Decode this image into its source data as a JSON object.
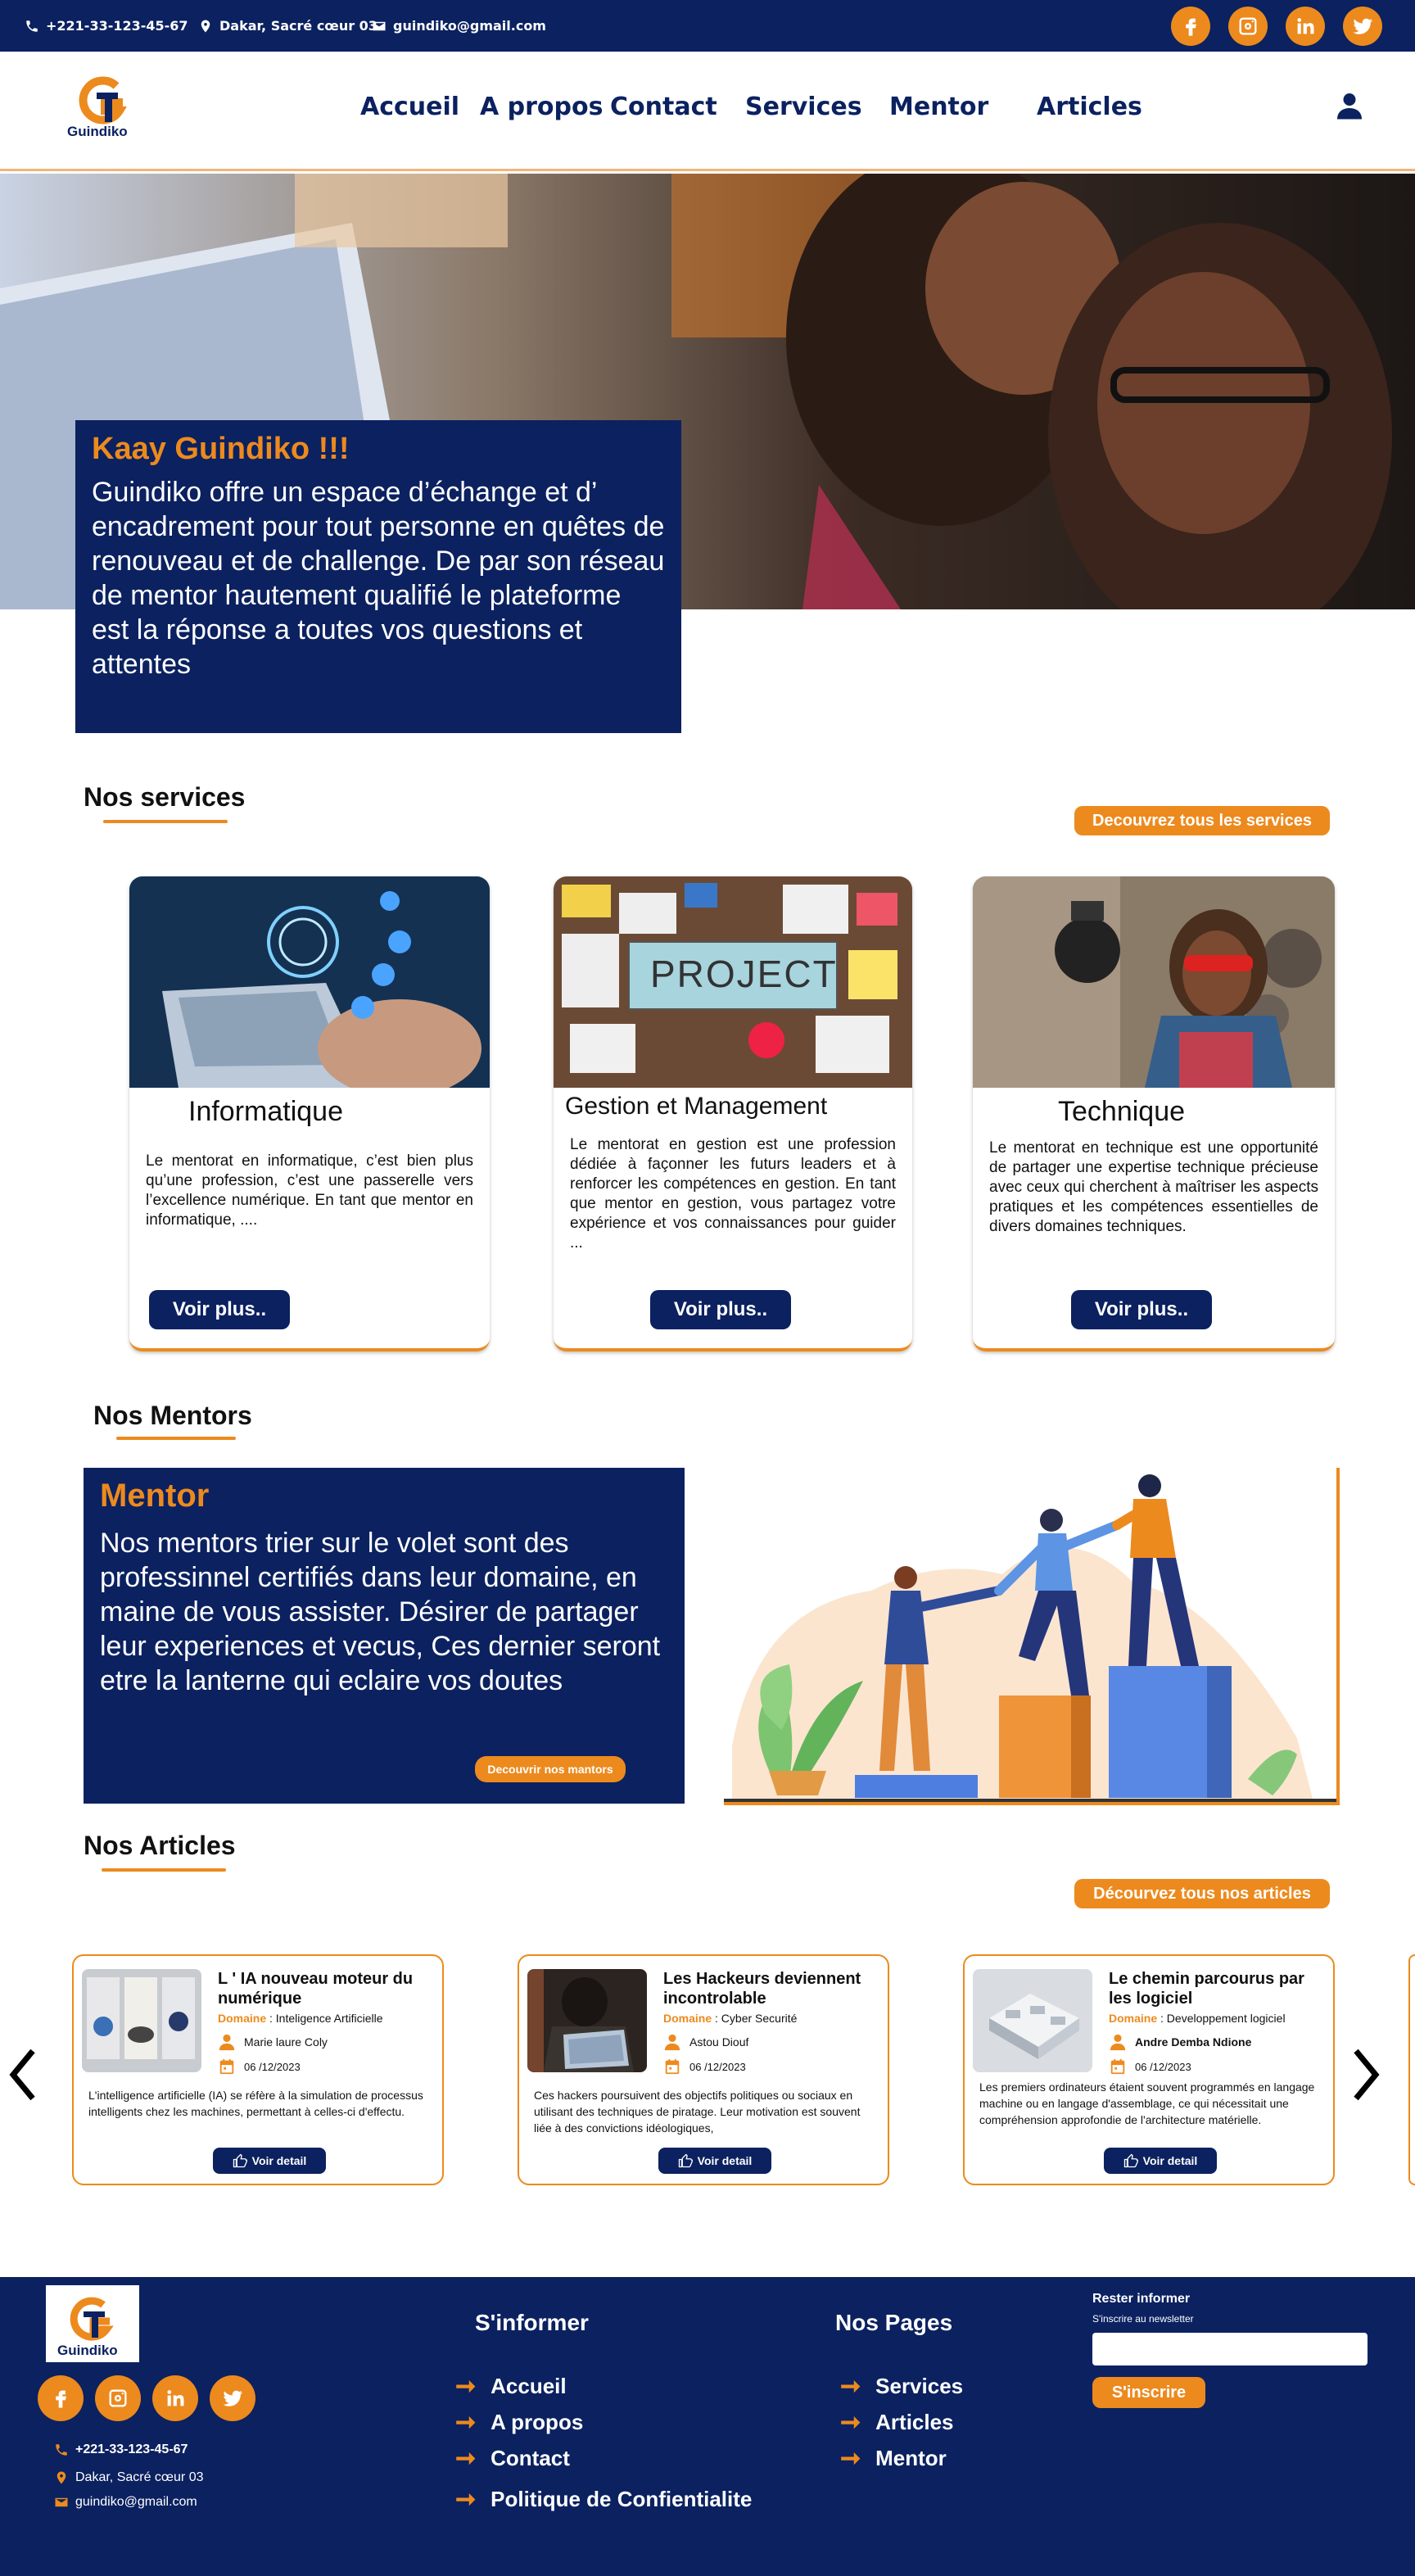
{
  "topbar": {
    "phone": "+221-33-123-45-67",
    "address": "Dakar, Sacré cœur 03",
    "email": "guindiko@gmail.com"
  },
  "brand": {
    "logo_text": "Guindiko",
    "logo_letter": "G"
  },
  "nav": {
    "items": [
      {
        "label": "Accueil"
      },
      {
        "label": "A propos"
      },
      {
        "label": "Contact"
      },
      {
        "label": "Services"
      },
      {
        "label": "Mentor"
      },
      {
        "label": "Articles"
      }
    ]
  },
  "hero": {
    "title": "Kaay Guindiko !!!",
    "text": "Guindiko offre un espace d’échange et d’ encadrement pour tout personne en quêtes de renouveau et de challenge. De par son réseau de mentor hautement qualifié le plateforme est la réponse a toutes vos questions et attentes"
  },
  "services": {
    "title": "Nos services",
    "all_button": "Decouvrez tous les services",
    "cards": [
      {
        "title": "Informatique",
        "text": "Le mentorat en informatique, c’est bien plus qu’une profession, c’est une passerelle vers l’excellence numérique. En tant que mentor en informatique, ....",
        "button": "Voir plus.."
      },
      {
        "title": "Gestion et Management",
        "text": "Le mentorat en gestion est une profession dédiée à façonner les futurs leaders et à renforcer les compétences en gestion. En tant que mentor en gestion, vous partagez votre expérience et vos connaissances pour guider ...",
        "button": "Voir plus..",
        "image_label": "PROJECT"
      },
      {
        "title": "Technique",
        "text": "Le mentorat en technique est une opportunité de partager une expertise technique précieuse avec ceux qui cherchent à maîtriser les aspects pratiques et les compétences essentielles de divers domaines techniques.",
        "button": "Voir plus.."
      }
    ]
  },
  "mentors": {
    "title": "Nos Mentors",
    "box_title": "Mentor",
    "text": "Nos mentors trier sur le volet sont des professinnel certifiés dans leur domaine, en maine de vous assister. Désirer de partager leur experiences et vecus, Ces dernier seront etre la lanterne qui eclaire vos doutes",
    "button": "Decouvrir nos mantors"
  },
  "articles": {
    "title": "Nos Articles",
    "all_button": "Décourvez tous nos articles",
    "domain_label": "Domaine",
    "items": [
      {
        "title": "L ' IA  nouveau moteur du numérique",
        "domain": "Inteligence Artificielle",
        "author": "Marie laure Coly",
        "date": "06 /12/2023",
        "text": "L'intelligence artificielle (IA) se réfère à la simulation de processus intelligents chez les machines, permettant à celles-ci d'effectu.",
        "button": "Voir detail"
      },
      {
        "title": "Les Hackeurs deviennent incontrolable",
        "domain": "Cyber Securité",
        "author": "Astou Diouf",
        "date": "06 /12/2023",
        "text": "Ces hackers poursuivent des objectifs politiques ou sociaux en utilisant des techniques de piratage. Leur motivation est souvent liée à des convictions idéologiques,",
        "button": "Voir detail"
      },
      {
        "title": "Le chemin parcourus par les logiciel",
        "domain": "Developpement logiciel",
        "author": "Andre Demba Ndione",
        "date": "06 /12/2023",
        "text": "Les premiers ordinateurs étaient souvent programmés en langage machine ou en langage d'assemblage, ce qui nécessitait une compréhension approfondie de l'architecture matérielle.",
        "button": "Voir detail"
      }
    ]
  },
  "footer": {
    "logo_text": "Guindiko",
    "phone": "+221-33-123-45-67",
    "address": "Dakar, Sacré cœur 03",
    "email": "guindiko@gmail.com",
    "col1_title": "S'informer",
    "col1_links": [
      "Accueil",
      "A propos",
      "Contact",
      "Politique de Confientialite"
    ],
    "col2_title": "Nos Pages",
    "col2_links": [
      "Services",
      "Articles",
      "Mentor"
    ],
    "newsletter_title": "Rester informer",
    "newsletter_sub": "S'inscrire au newsletter",
    "newsletter_placeholder": "",
    "newsletter_button": "S'inscrire"
  },
  "colors": {
    "navy": "#0b2160",
    "orange": "#ec8a1e"
  },
  "icons": [
    "phone-icon",
    "location-icon",
    "mail-icon",
    "facebook-icon",
    "instagram-icon",
    "linkedin-icon",
    "twitter-icon",
    "user-icon",
    "chevron-left-icon",
    "chevron-right-icon",
    "thumbs-up-icon",
    "calendar-icon",
    "arrow-right-icon"
  ]
}
